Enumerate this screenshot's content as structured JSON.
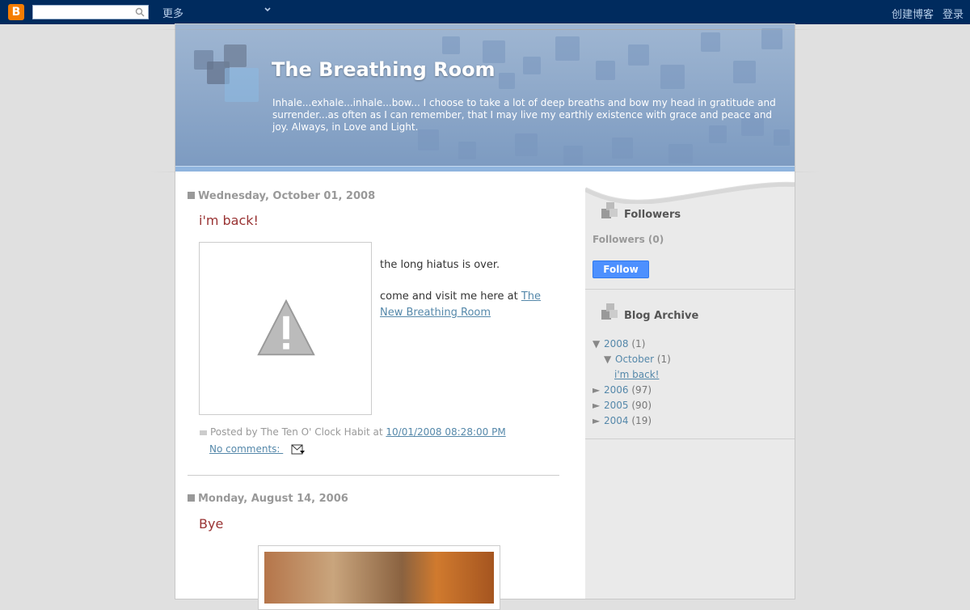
{
  "navbar": {
    "search_placeholder": "",
    "more_label": "更多",
    "create_blog_label": "创建博客",
    "login_label": "登录"
  },
  "blog": {
    "title": "The Breathing Room",
    "description": "Inhale...exhale...inhale...bow... I choose to take a lot of deep breaths and bow my head in gratitude and surrender...as often as I can remember, that I may live my earthly existence with grace and peace and joy. Always, in Love and Light."
  },
  "posts": [
    {
      "date": "Wednesday, October 01, 2008",
      "title": "i'm back!",
      "body_line1": "the long hiatus is over.",
      "body_line2_prefix": "come and visit me here at ",
      "body_link": "The New Breathing Room",
      "posted_by_prefix": "Posted by The Ten O' Clock Habit at ",
      "timestamp": "10/01/2008 08:28:00 PM",
      "comments": "No comments: "
    },
    {
      "date": "Monday, August 14, 2006",
      "title": "Bye"
    }
  ],
  "sidebar": {
    "followers_title": "Followers",
    "followers_count": "Followers (0)",
    "follow_button": "Follow",
    "archive_title": "Blog Archive",
    "archive": [
      {
        "label": "2008",
        "count": "(1)",
        "expanded": true
      },
      {
        "label": "October",
        "count": "(1)",
        "expanded": true
      },
      {
        "label": "i'm back!"
      },
      {
        "label": "2006",
        "count": "(97)"
      },
      {
        "label": "2005",
        "count": "(90)"
      },
      {
        "label": "2004",
        "count": "(19)"
      }
    ]
  },
  "colors": {
    "navbar": "#002b5e",
    "post_title": "#993333",
    "link": "#5588aa",
    "follow_button": "#4d90fe"
  }
}
